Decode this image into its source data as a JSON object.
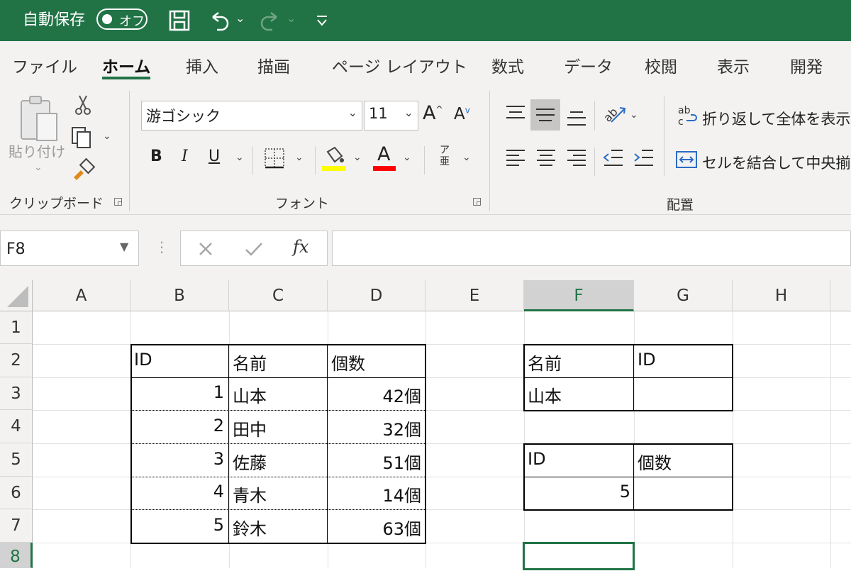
{
  "titlebar": {
    "autosave_label": "自動保存",
    "autosave_toggle": "オフ"
  },
  "tabs": [
    "ファイル",
    "ホーム",
    "挿入",
    "描画",
    "ページ レイアウト",
    "数式",
    "データ",
    "校閲",
    "表示",
    "開発"
  ],
  "ribbon": {
    "clipboard": {
      "paste_label": "貼り付け",
      "group_label": "クリップボード"
    },
    "font": {
      "font_name": "游ゴシック",
      "font_size": "11",
      "bold": "B",
      "italic": "I",
      "underline": "U",
      "font_color_glyph": "A",
      "phonetic_top": "ア",
      "phonetic_bottom": "亜",
      "group_label": "フォント"
    },
    "alignment": {
      "wrap_text": "折り返して全体を表示す",
      "merge_center": "セルを結合して中央揃え",
      "group_label": "配置",
      "wrap_icon_text": "ab\nc"
    }
  },
  "formula_bar": {
    "name_box": "F8",
    "fx_label": "fx",
    "formula": ""
  },
  "columns": [
    "A",
    "B",
    "C",
    "D",
    "E",
    "F",
    "G",
    "H"
  ],
  "rows": [
    "1",
    "2",
    "3",
    "4",
    "5",
    "6",
    "7",
    "8"
  ],
  "selected_cell": "F8",
  "sheet": {
    "table1": {
      "headers": [
        "ID",
        "名前",
        "個数"
      ],
      "rows": [
        [
          "1",
          "山本",
          "42個"
        ],
        [
          "2",
          "田中",
          "32個"
        ],
        [
          "3",
          "佐藤",
          "51個"
        ],
        [
          "4",
          "青木",
          "14個"
        ],
        [
          "5",
          "鈴木",
          "63個"
        ]
      ]
    },
    "table2": {
      "headers": [
        "名前",
        "ID"
      ],
      "row": [
        "山本",
        ""
      ]
    },
    "table3": {
      "headers": [
        "ID",
        "個数"
      ],
      "row": [
        "5",
        ""
      ]
    }
  },
  "colors": {
    "excel_green": "#217346",
    "highlight_yellow": "#ffff00",
    "font_red": "#ff0000"
  }
}
